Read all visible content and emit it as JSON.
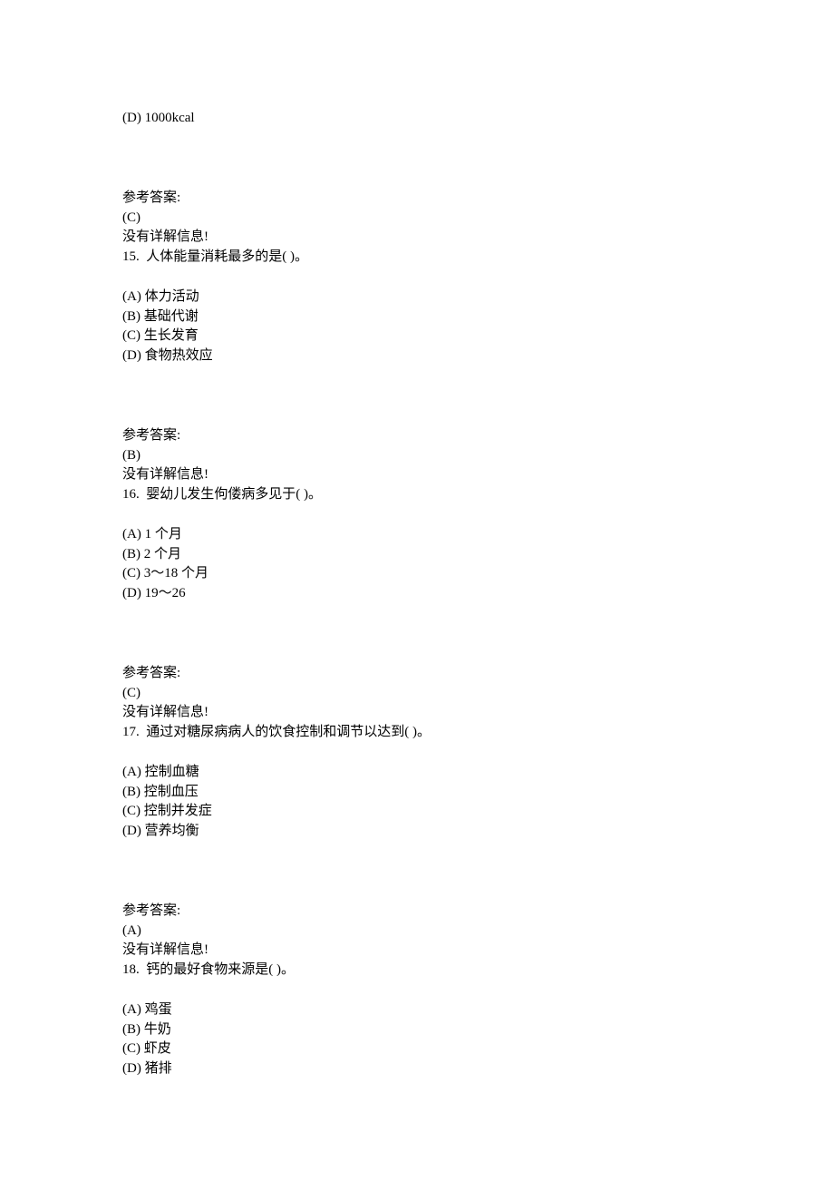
{
  "q14_option_d": "(D) 1000kcal",
  "answer_label": "参考答案:",
  "no_explanation": "没有详解信息!",
  "q14_answer": "(C)",
  "q15": {
    "stem": "15.  人体能量消耗最多的是( )。",
    "options": {
      "a": "(A) 体力活动",
      "b": "(B) 基础代谢",
      "c": "(C) 生长发育",
      "d": "(D) 食物热效应"
    },
    "answer": "(B)"
  },
  "q16": {
    "stem": "16.  婴幼儿发生佝偻病多见于( )。",
    "options": {
      "a": "(A) 1 个月",
      "b": "(B) 2 个月",
      "c": "(C) 3～18 个月",
      "d": "(D) 19～26"
    },
    "answer": "(C)"
  },
  "q17": {
    "stem": "17.  通过对糖尿病病人的饮食控制和调节以达到( )。",
    "options": {
      "a": "(A) 控制血糖",
      "b": "(B) 控制血压",
      "c": "(C) 控制并发症",
      "d": "(D) 营养均衡"
    },
    "answer": "(A)"
  },
  "q18": {
    "stem": "18.  钙的最好食物来源是( )。",
    "options": {
      "a": "(A) 鸡蛋",
      "b": "(B) 牛奶",
      "c": "(C) 虾皮",
      "d": "(D) 猪排"
    }
  }
}
